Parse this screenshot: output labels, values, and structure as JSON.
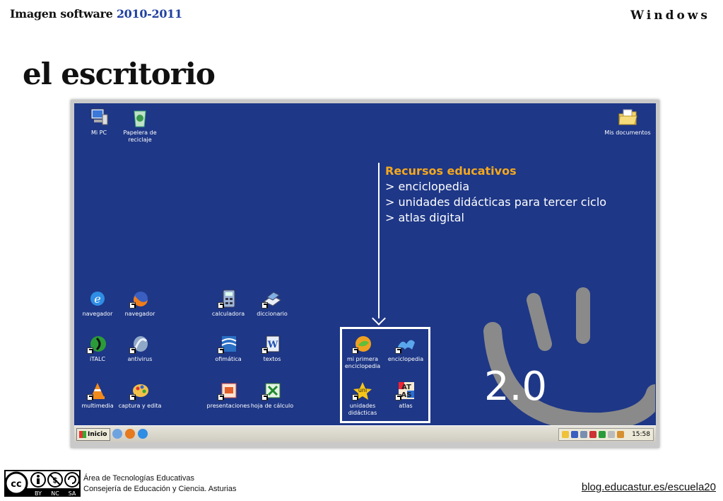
{
  "header": {
    "left_prefix": "Imagen software ",
    "left_year": "2010-2011",
    "right": "Windows"
  },
  "slide_title": "el escritorio",
  "desktop": {
    "icons": {
      "mipc": "Mi PC",
      "papelera": "Papelera de reciclaje",
      "misdocs": "Mis documentos",
      "navegador1": "navegador",
      "navegador2": "navegador",
      "calculadora": "calculadora",
      "diccionario": "diccionario",
      "italc": "iTALC",
      "antivirus": "antivirus",
      "ofimatica": "ofimática",
      "textos": "textos",
      "multimedia": "multimedia",
      "captura": "captura y edita",
      "presentaciones": "presentaciones",
      "hoja": "hoja de cálculo",
      "miprimera": "mi primera enciclopedia",
      "enciclopedia": "enciclopedia",
      "unidades": "unidades didácticas",
      "atlas": "atlas"
    },
    "resources": {
      "title": "Recursos educativos",
      "item1": "> enciclopedia",
      "item2": "> unidades didácticas para tercer ciclo",
      "item3": "> atlas digital"
    },
    "version": "2.0"
  },
  "taskbar": {
    "start_label": "Inicio",
    "clock": "15:58"
  },
  "footer": {
    "cc_by": "BY",
    "cc_nc": "NC",
    "cc_sa": "SA",
    "line1": "Área de Tecnologías Educativas",
    "line2": "Consejería de Educación y Ciencia. Asturias",
    "link": "blog.educastur.es/escuela20"
  },
  "colors": {
    "desktop_bg": "#1e3787",
    "accent_orange": "#f5a81c",
    "year_blue": "#1f3fa0"
  }
}
